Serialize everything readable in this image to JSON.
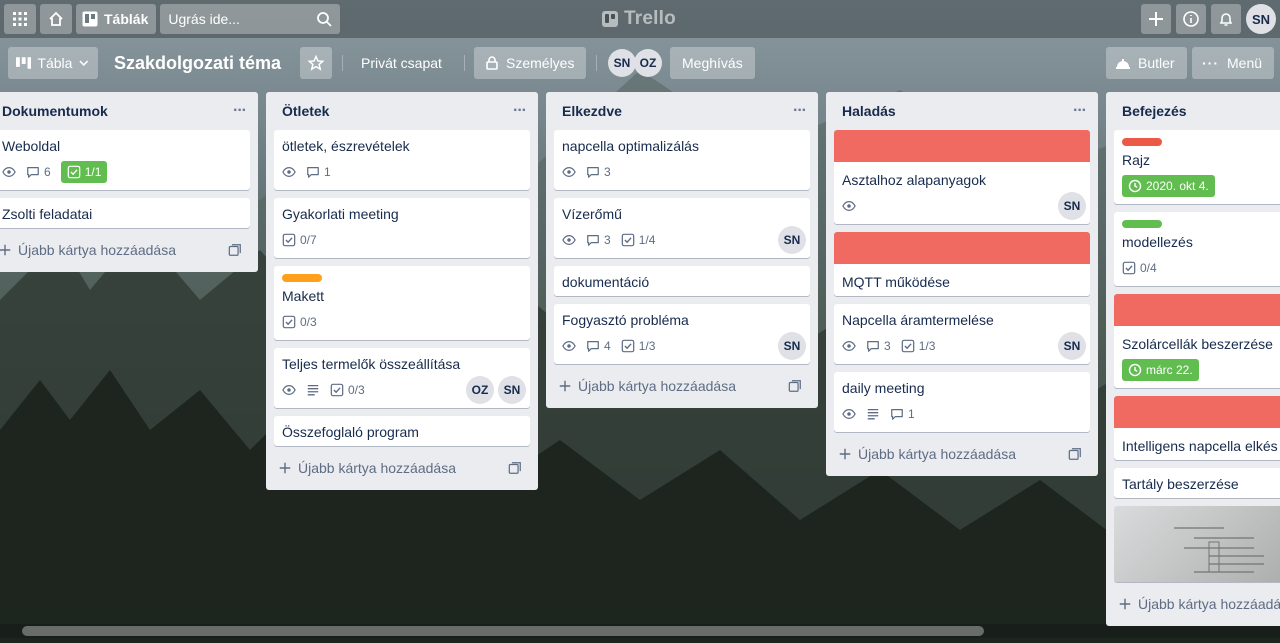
{
  "header": {
    "boards_label": "Táblák",
    "search_placeholder": "Ugrás ide...",
    "logo_text": "Trello",
    "user_initials": "SN"
  },
  "board": {
    "view_label": "Tábla",
    "title": "Szakdolgozati téma",
    "team_label": "Privát csapat",
    "visibility_label": "Személyes",
    "members": [
      "SN",
      "OZ"
    ],
    "invite_label": "Meghívás",
    "butler_label": "Butler",
    "menu_label": "Menü"
  },
  "add_card_label": "Újabb kártya hozzáadása",
  "colors": {
    "label_red": "#eb5a46",
    "label_green": "#61bd4f",
    "label_orange": "#ff9f1a",
    "cover_red": "#f06a62"
  },
  "lists": [
    {
      "title": "Dokumentumok",
      "cards": [
        {
          "title": "Weboldal",
          "comments": "6",
          "checklist": "1/1"
        },
        {
          "title": "Zsolti feladatai"
        }
      ]
    },
    {
      "title": "Ötletek",
      "cards": [
        {
          "title": "ötletek, észrevételek",
          "comments": "1"
        },
        {
          "title": "Gyakorlati meeting",
          "checklist": "0/7"
        },
        {
          "title": "Makett",
          "checklist": "0/3"
        },
        {
          "title": "Teljes termelők összeállítása",
          "checklist": "0/3",
          "members": [
            "OZ",
            "SN"
          ]
        },
        {
          "title": "Összefoglaló program"
        }
      ]
    },
    {
      "title": "Elkezdve",
      "cards": [
        {
          "title": "napcella optimalizálás",
          "comments": "3"
        },
        {
          "title": "Vízerőmű",
          "comments": "3",
          "checklist": "1/4",
          "members": [
            "SN"
          ]
        },
        {
          "title": "dokumentáció"
        },
        {
          "title": "Fogyasztó probléma",
          "comments": "4",
          "checklist": "1/3",
          "members": [
            "SN"
          ]
        }
      ]
    },
    {
      "title": "Haladás",
      "cards": [
        {
          "title": "Asztalhoz alapanyagok",
          "members": [
            "SN"
          ]
        },
        {
          "title": "MQTT működése"
        },
        {
          "title": "Napcella áramtermelése",
          "comments": "3",
          "checklist": "1/3",
          "members": [
            "SN"
          ]
        },
        {
          "title": "daily meeting",
          "comments": "1"
        }
      ]
    },
    {
      "title": "Befejezés",
      "cards": [
        {
          "title": "Rajz",
          "due": "2020. okt 4."
        },
        {
          "title": "modellezés",
          "checklist": "0/4"
        },
        {
          "title": "Szolárcellák beszerzése",
          "due": "márc 22."
        },
        {
          "title": "Intelligens napcella elkés"
        },
        {
          "title": "Tartály beszerzése"
        }
      ]
    }
  ]
}
